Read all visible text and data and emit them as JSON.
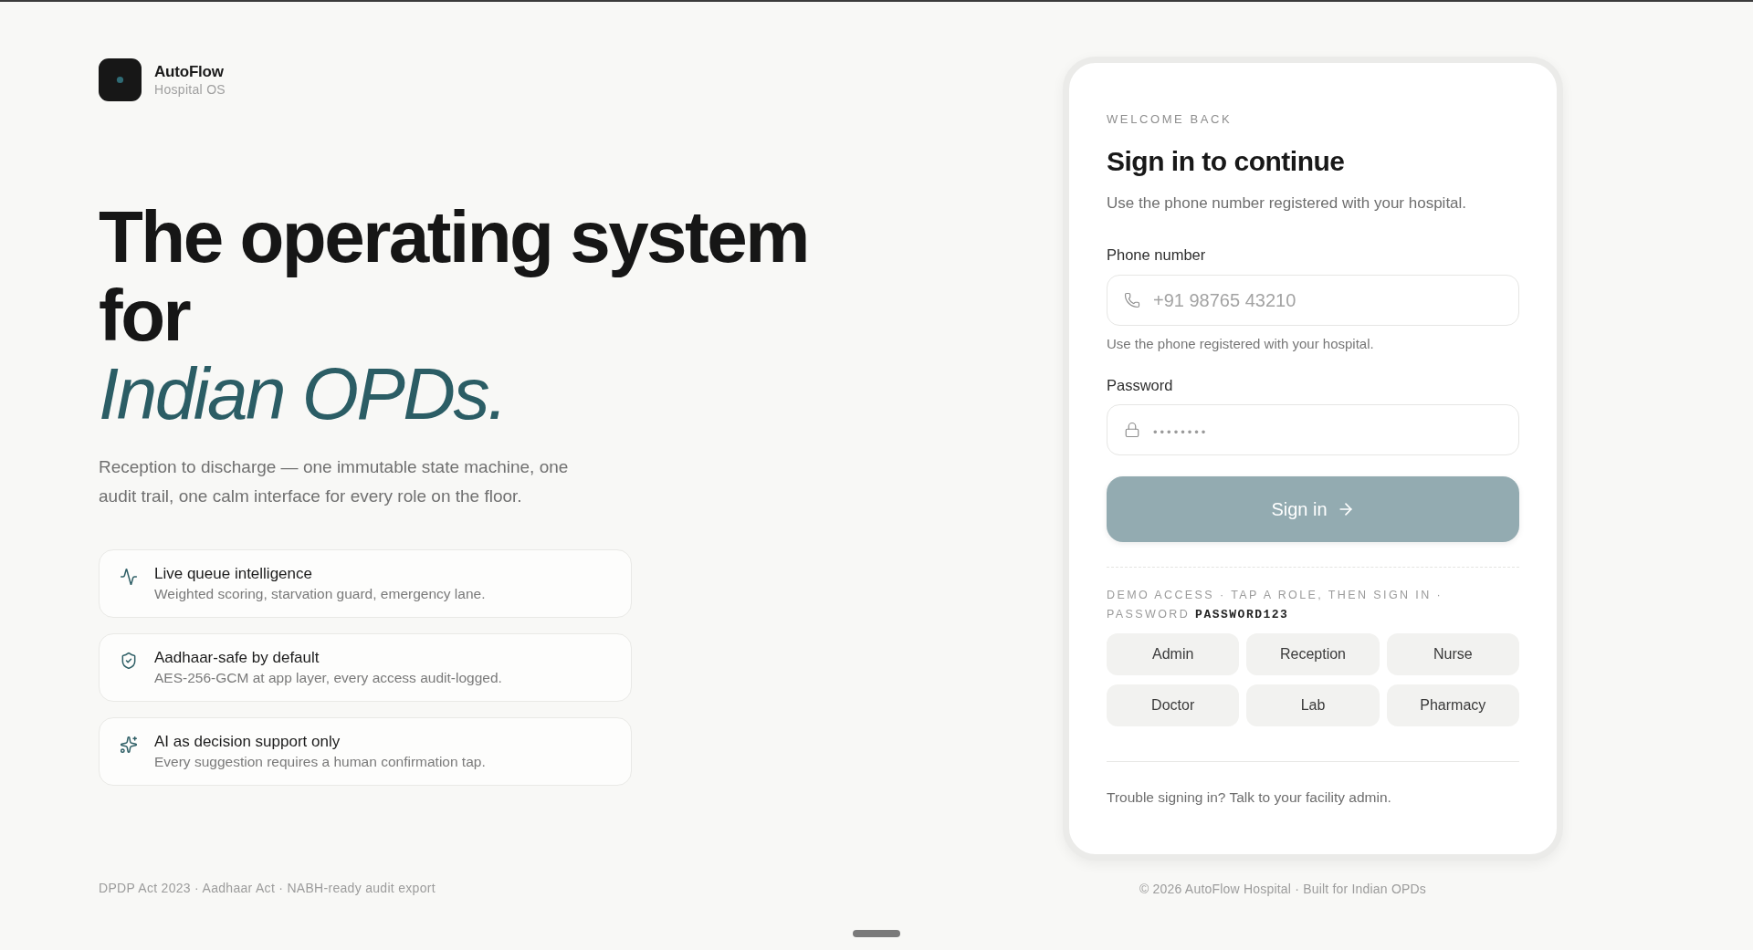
{
  "brand": {
    "name": "AutoFlow",
    "tagline": "Hospital OS"
  },
  "hero": {
    "headline": "The operating system for",
    "headline_accent": "Indian OPDs.",
    "description": "Reception to discharge — one immutable state machine, one audit trail, one calm interface for every role on the floor."
  },
  "features": [
    {
      "title": "Live queue intelligence",
      "description": "Weighted scoring, starvation guard, emergency lane."
    },
    {
      "title": "Aadhaar-safe by default",
      "description": "AES-256-GCM at app layer, every access audit-logged."
    },
    {
      "title": "AI as decision support only",
      "description": "Every suggestion requires a human confirmation tap."
    }
  ],
  "left_footer": "DPDP Act 2023 · Aadhaar Act · NABH-ready audit export",
  "sign_in": {
    "eyebrow": "WELCOME BACK",
    "title": "Sign in to continue",
    "subtitle": "Use the phone number registered with your hospital.",
    "phone": {
      "label": "Phone number",
      "placeholder": "+91 98765 43210",
      "hint": "Use the phone registered with your hospital."
    },
    "password": {
      "label": "Password",
      "placeholder": "••••••••"
    },
    "submit": {
      "label": "Sign in",
      "disabled": true
    },
    "demo": {
      "note": "DEMO ACCESS · TAP A ROLE, THEN SIGN IN · PASSWORD",
      "password": "PASSWORD123"
    },
    "roles": [
      {
        "label": "Admin",
        "selected": false
      },
      {
        "label": "Reception",
        "selected": false
      },
      {
        "label": "Nurse",
        "selected": false
      },
      {
        "label": "Doctor",
        "selected": false
      },
      {
        "label": "Lab",
        "selected": false
      },
      {
        "label": "Pharmacy",
        "selected": false
      }
    ],
    "help": "Trouble signing in? Talk to your facility admin."
  },
  "right_footer": "© 2026 AutoFlow Hospital · Built for Indian OPDs"
}
